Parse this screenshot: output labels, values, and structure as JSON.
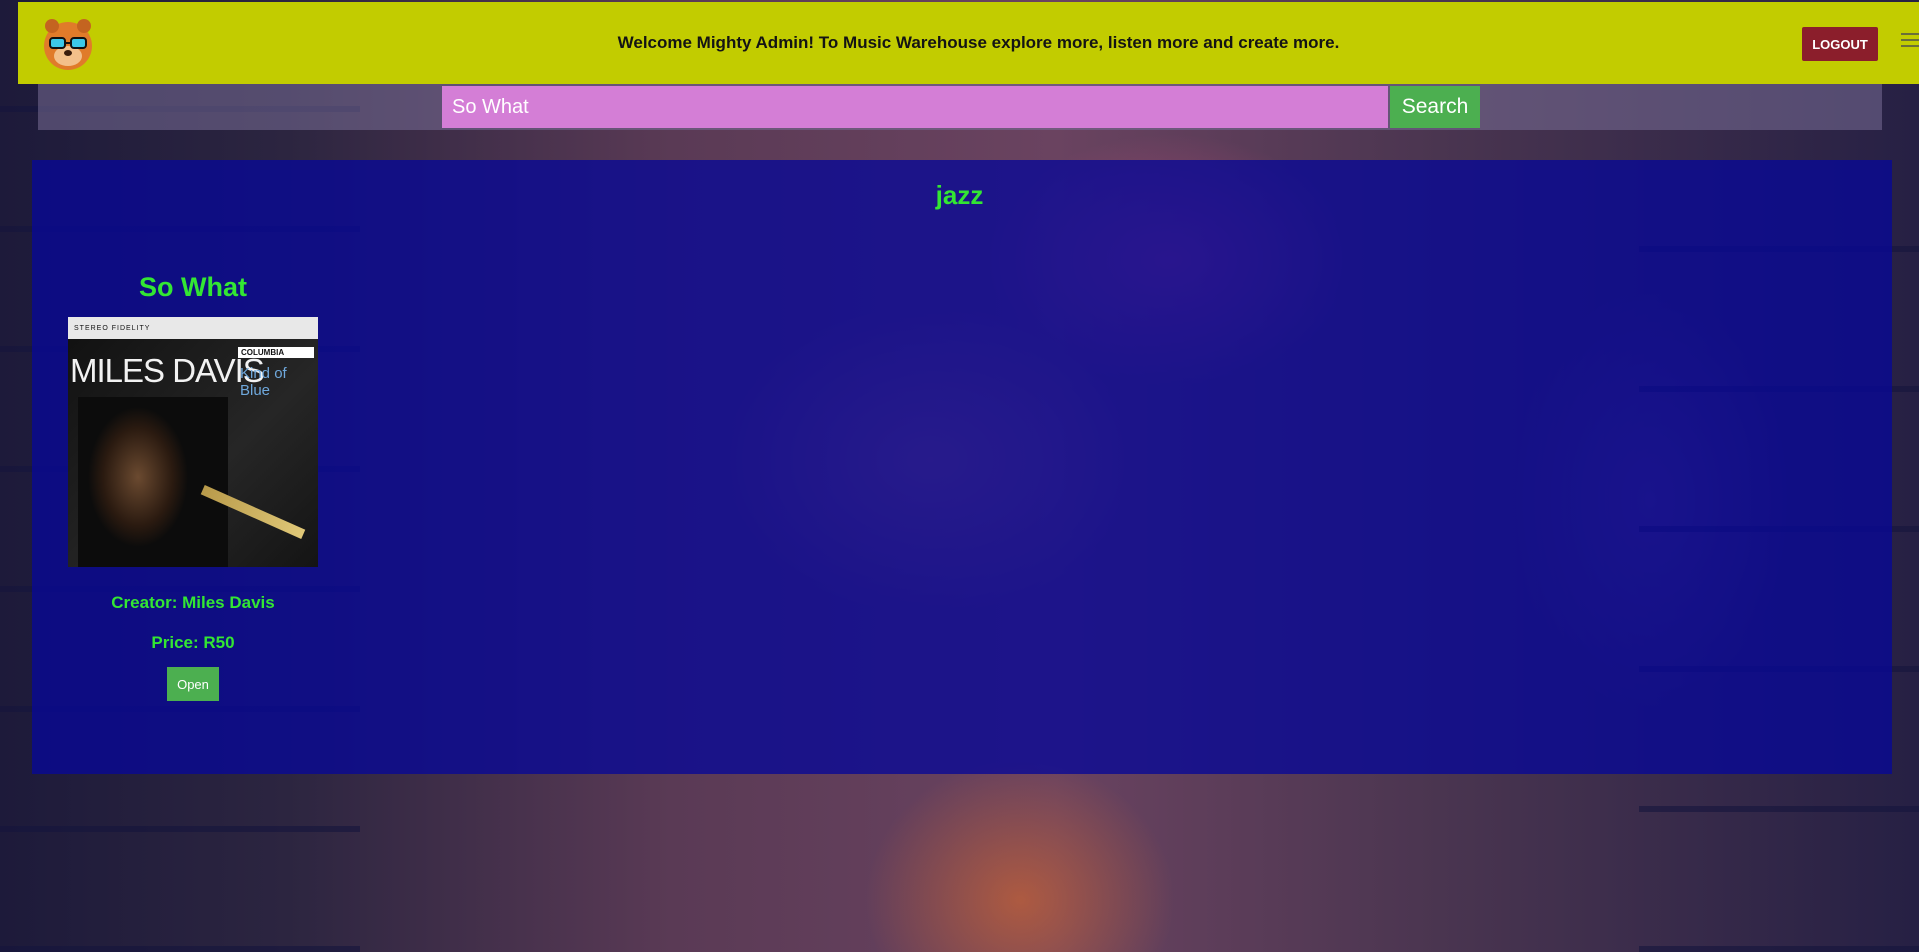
{
  "header": {
    "welcome": "Welcome Mighty Admin! To Music Warehouse explore more, listen more and create more.",
    "logout_label": "LOGOUT"
  },
  "search": {
    "value": "So What",
    "button_label": "Search"
  },
  "results": {
    "category": "jazz",
    "items": [
      {
        "title": "So What",
        "cover": {
          "top_text": "STEREO  FIDELITY",
          "artist": "MILES DAVIS",
          "label": "COLUMBIA",
          "album": "Kind of Blue"
        },
        "creator": "Creator: Miles Davis",
        "price": "Price: R50",
        "open_label": "Open"
      }
    ]
  },
  "colors": {
    "header_bg": "#c2cc00",
    "logout_bg": "#8b1e2b",
    "search_input_bg": "#d47ed6",
    "button_green": "#4caf50",
    "panel_bg": "#0808a0",
    "text_green": "#33e633"
  },
  "icons": {
    "logo": "cartoon-mascot-with-glasses-icon",
    "menu": "hamburger-menu-icon"
  }
}
